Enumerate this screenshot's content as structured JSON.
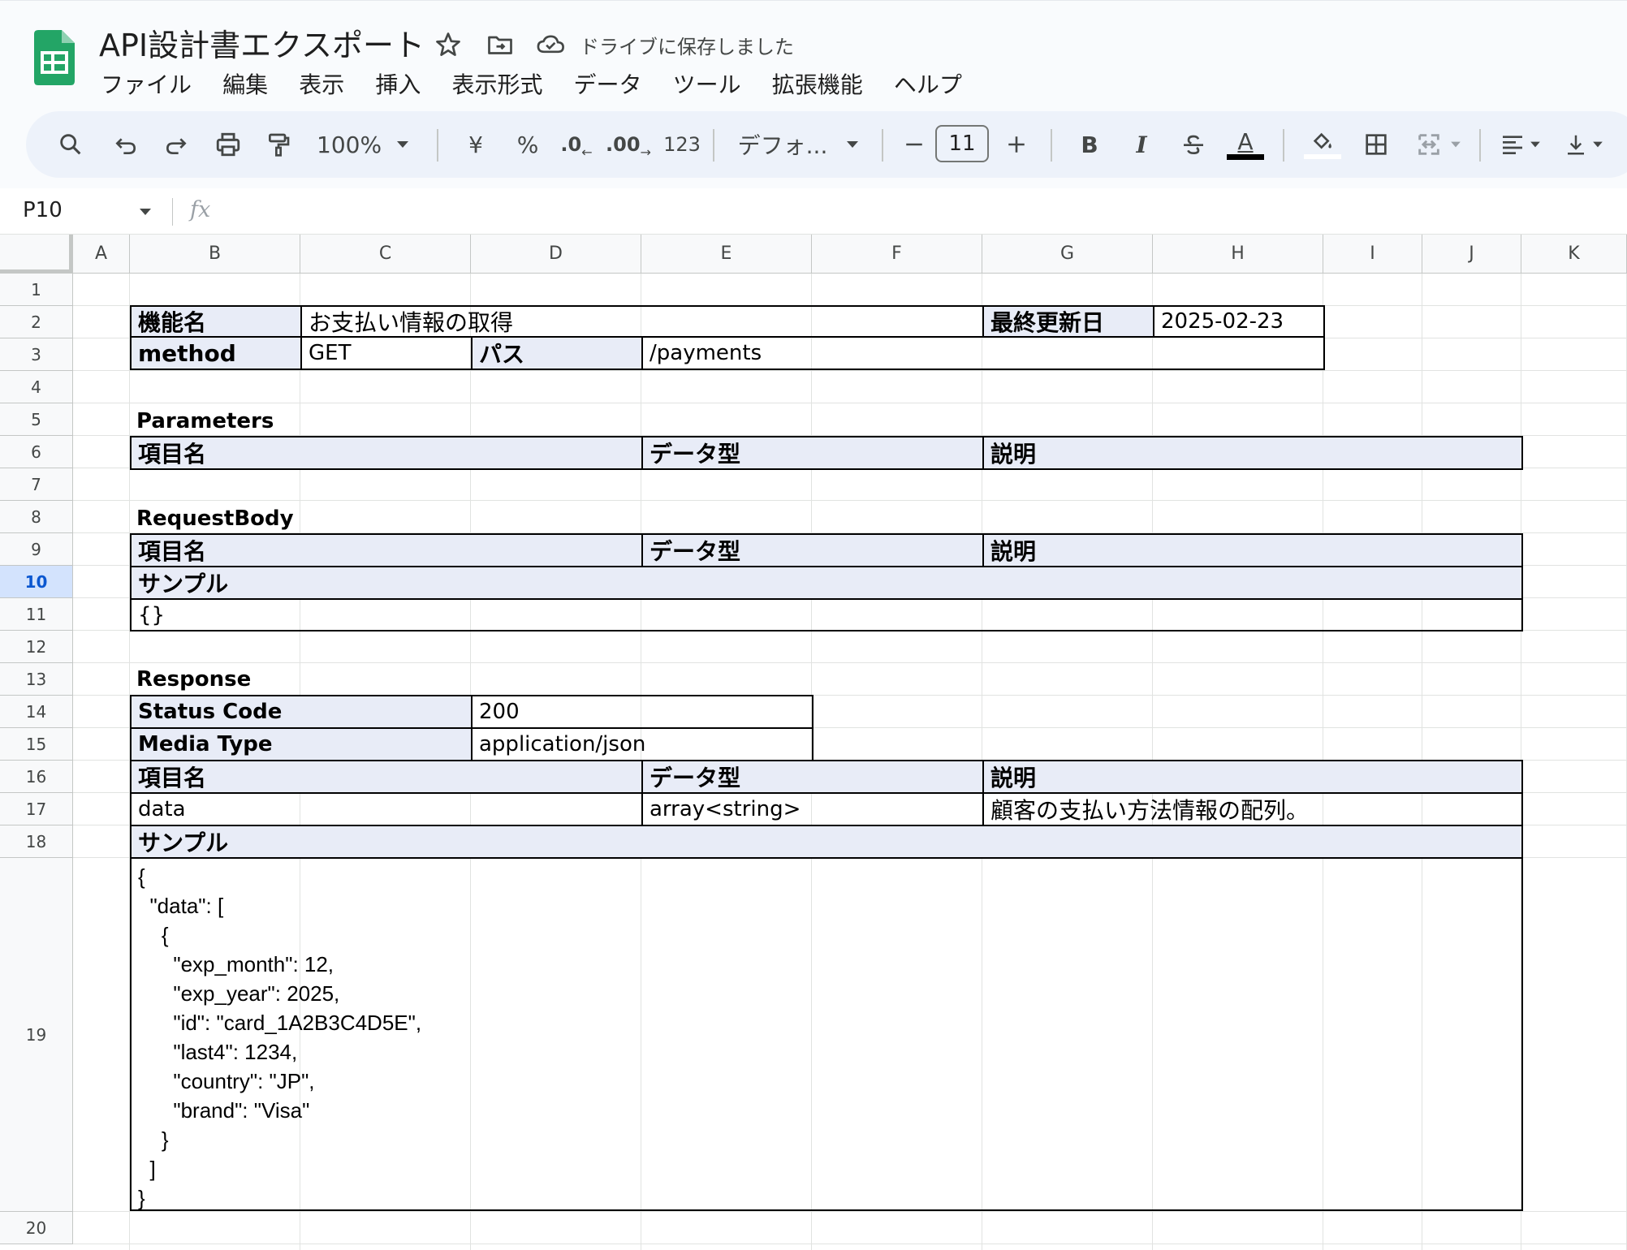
{
  "app": {
    "title": "API設計書エクスポート",
    "save_status": "ドライブに保存しました",
    "menu": [
      "ファイル",
      "編集",
      "表示",
      "挿入",
      "表示形式",
      "データ",
      "ツール",
      "拡張機能",
      "ヘルプ"
    ]
  },
  "toolbar": {
    "zoom": "100%",
    "currency": "¥",
    "percent": "%",
    "decrease_decimal": ".0",
    "increase_decimal": ".00",
    "number_format": "123",
    "font": "デフォ...",
    "font_size": "11",
    "bold": "B",
    "italic": "I",
    "text_color": "A"
  },
  "formula_bar": {
    "cell_ref": "P10",
    "fx": "fx",
    "value": ""
  },
  "columns": [
    "A",
    "B",
    "C",
    "D",
    "E",
    "F",
    "G",
    "H",
    "I",
    "J",
    "K"
  ],
  "rows": [
    "1",
    "2",
    "3",
    "4",
    "5",
    "6",
    "7",
    "8",
    "9",
    "10",
    "11",
    "12",
    "13",
    "14",
    "15",
    "16",
    "17",
    "18",
    "19",
    "20"
  ],
  "active_row": "10",
  "sheet": {
    "func_label": "機能名",
    "func_value": "お支払い情報の取得",
    "updated_label": "最終更新日",
    "updated_value": "2025-02-23",
    "method_label": "method",
    "method_value": "GET",
    "path_label": "パス",
    "path_value": "/payments",
    "parameters_title": "Parameters",
    "param_col_name": "項目名",
    "param_col_type": "データ型",
    "param_col_desc": "説明",
    "request_title": "RequestBody",
    "req_col_name": "項目名",
    "req_col_type": "データ型",
    "req_col_desc": "説明",
    "req_sample_label": "サンプル",
    "req_sample_value": "{}",
    "response_title": "Response",
    "status_label": "Status Code",
    "status_value": "200",
    "media_label": "Media Type",
    "media_value": "application/json",
    "res_col_name": "項目名",
    "res_col_type": "データ型",
    "res_col_desc": "説明",
    "res_row_name": "data",
    "res_row_type": "array<string>",
    "res_row_desc": "顧客の支払い方法情報の配列。",
    "res_sample_label": "サンプル",
    "res_sample_value": "{\n  \"data\": [\n    {\n      \"exp_month\": 12,\n      \"exp_year\": 2025,\n      \"id\": \"card_1A2B3C4D5E\",\n      \"last4\": 1234,\n      \"country\": \"JP\",\n      \"brand\": \"Visa\"\n    }\n  ]\n}"
  }
}
